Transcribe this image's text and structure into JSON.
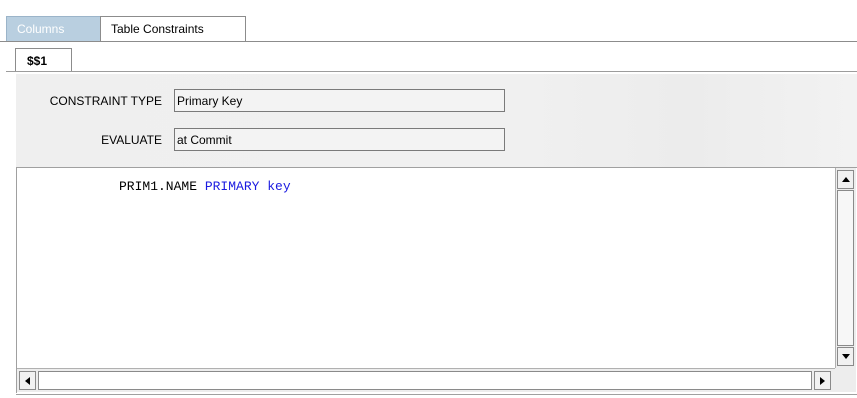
{
  "outer_tabs": [
    {
      "label": "Columns",
      "selected": false
    },
    {
      "label": "Table Constraints",
      "selected": true
    }
  ],
  "inner_tabs": [
    {
      "label": "$$1",
      "selected": true
    }
  ],
  "form": {
    "constraint_type_label": "CONSTRAINT TYPE",
    "constraint_type_value": "Primary Key",
    "evaluate_label": "EVALUATE",
    "evaluate_value": "at Commit"
  },
  "editor": {
    "code_identifier": "PRIM1.NAME",
    "code_keyword": "PRIMARY key",
    "keyword_color": "#1a1ae0"
  },
  "icons": {
    "scroll_up": "triangle-up-icon",
    "scroll_down": "triangle-down-icon",
    "scroll_left": "triangle-left-icon",
    "scroll_right": "triangle-right-icon"
  }
}
